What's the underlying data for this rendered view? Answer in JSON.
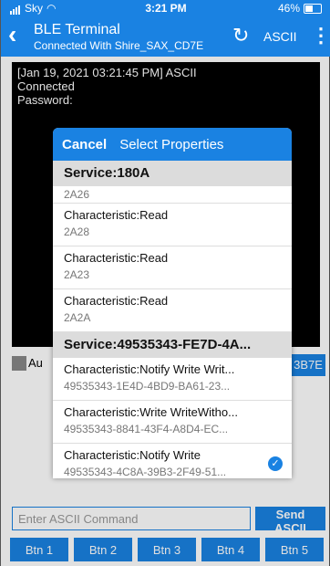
{
  "status_bar": {
    "carrier": "Sky",
    "time": "3:21 PM",
    "battery": "46%"
  },
  "nav": {
    "back_icon": "chevron-left",
    "title": "BLE Terminal",
    "subtitle": "Connected With Shire_SAX_CD7E",
    "refresh_icon": "refresh",
    "mode": "ASCII",
    "more_icon": "vertical-ellipsis"
  },
  "terminal": {
    "lines": [
      "[Jan 19, 2021 03:21:45 PM] ASCII",
      "Connected",
      "Password:"
    ]
  },
  "background_controls": {
    "auto_label": "Au",
    "device_button": "3B7E"
  },
  "modal": {
    "cancel_label": "Cancel",
    "title": "Select Properties",
    "services": [
      {
        "name": "Service:180A",
        "characteristics": [
          {
            "name": "",
            "uuid": "2A26"
          },
          {
            "name": "Characteristic:Read",
            "uuid": "2A28"
          },
          {
            "name": "Characteristic:Read",
            "uuid": "2A23"
          },
          {
            "name": "Characteristic:Read",
            "uuid": "2A2A"
          }
        ]
      },
      {
        "name": "Service:49535343-FE7D-4A...",
        "characteristics": [
          {
            "name": "Characteristic:Notify Write Writ...",
            "uuid": "49535343-1E4D-4BD9-BA61-23..."
          },
          {
            "name": "Characteristic:Write WriteWitho...",
            "uuid": "49535343-8841-43F4-A8D4-EC..."
          },
          {
            "name": "Characteristic:Notify Write",
            "uuid": "49535343-4C8A-39B3-2F49-51...",
            "selected": true
          }
        ]
      }
    ]
  },
  "command": {
    "placeholder": "Enter ASCII Command",
    "send_label": "Send ASCII"
  },
  "buttons": [
    "Btn 1",
    "Btn 2",
    "Btn 3",
    "Btn 4",
    "Btn 5"
  ]
}
